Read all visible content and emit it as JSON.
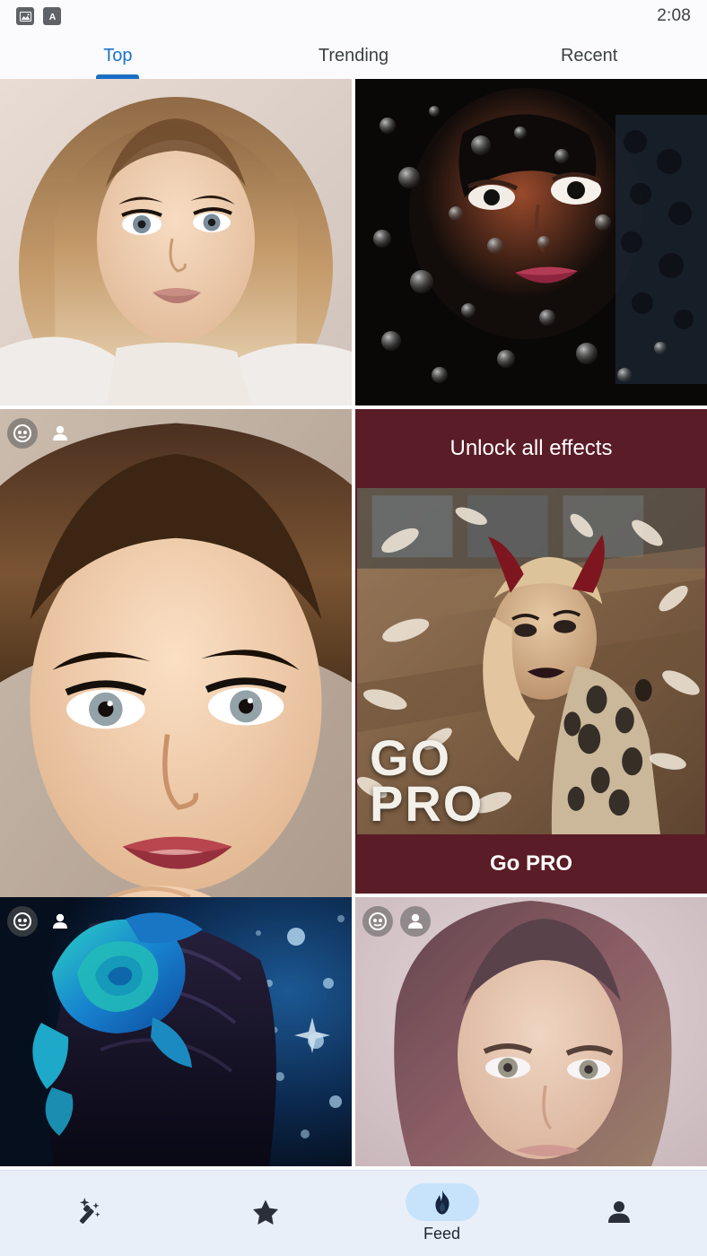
{
  "status_bar": {
    "icons": [
      {
        "name": "image-notification-icon",
        "glyph": "image"
      },
      {
        "name": "letter-a-notification-icon",
        "glyph": "letter-a"
      }
    ],
    "time": "2:08"
  },
  "tabs": {
    "items": [
      {
        "label": "Top",
        "active": true
      },
      {
        "label": "Trending",
        "active": false
      },
      {
        "label": "Recent",
        "active": false
      }
    ],
    "active_color": "#1a73cc",
    "inactive_color": "#3c4043",
    "indicator_color": "#1a6fc4"
  },
  "feed": {
    "tiles": [
      {
        "id": "tile-1",
        "description": "Digital art portrait of a blonde woman looking upward",
        "badges": []
      },
      {
        "id": "tile-2",
        "description": "Dark photo of a face behind a rain covered window",
        "badges": []
      },
      {
        "id": "tile-3",
        "description": "Digital art portrait of a brunette woman with hand at her chin",
        "badges": [
          "face-effect-icon",
          "person-icon"
        ]
      },
      {
        "id": "tile-4",
        "description": "Soft focus portrait of a woman with mauve toning",
        "badges": [
          "face-effect-icon",
          "person-icon"
        ]
      },
      {
        "id": "tile-5",
        "description": "Blue rose in dark hair with sparkles",
        "badges": [
          "face-effect-icon",
          "person-icon"
        ]
      }
    ]
  },
  "promo": {
    "headline": "Unlock all effects",
    "cta_label": "Go PRO",
    "image_overlay_line1": "GO",
    "image_overlay_line2": "PRO",
    "image_description": "Woman with devil horns surrounded by falling feathers",
    "background_color": "#5a1c26",
    "text_color": "#ffffff"
  },
  "bottom_nav": {
    "items": [
      {
        "name": "effects",
        "icon": "magic-wand-icon",
        "label": "",
        "active": false
      },
      {
        "name": "favorites",
        "icon": "star-icon",
        "label": "",
        "active": false
      },
      {
        "name": "feed",
        "icon": "flame-icon",
        "label": "Feed",
        "active": true
      },
      {
        "name": "profile",
        "icon": "person-icon",
        "label": "",
        "active": false
      }
    ],
    "background_color": "#e9eff8",
    "active_pill_color": "#c7e3fb"
  }
}
